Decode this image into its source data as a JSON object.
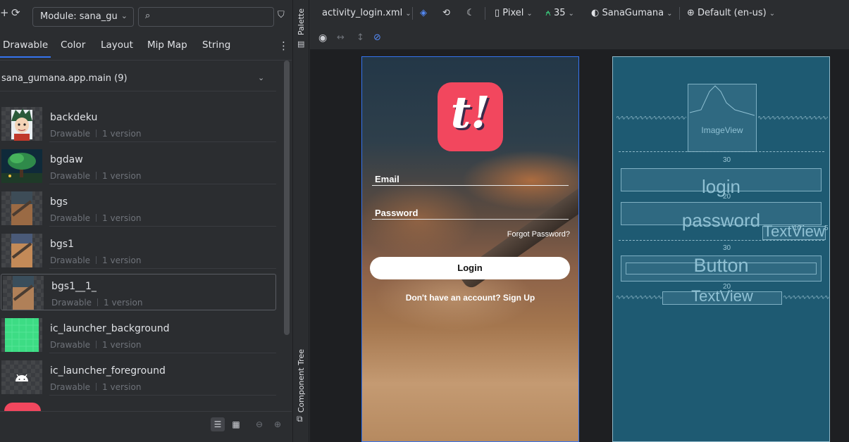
{
  "left_panel": {
    "module_label": "Module: sana_gu",
    "search_placeholder": "",
    "tabs": [
      {
        "label": "Drawable",
        "active": true
      },
      {
        "label": "Color"
      },
      {
        "label": "Layout"
      },
      {
        "label": "Mip Map"
      },
      {
        "label": "String"
      }
    ],
    "group_header": "sana_gumana.app.main (9)",
    "resources": [
      {
        "name": "backdeku",
        "type": "Drawable",
        "versions": "1 version"
      },
      {
        "name": "bgdaw",
        "type": "Drawable",
        "versions": "1 version"
      },
      {
        "name": "bgs",
        "type": "Drawable",
        "versions": "1 version"
      },
      {
        "name": "bgs1",
        "type": "Drawable",
        "versions": "1 version"
      },
      {
        "name": "bgs1__1_",
        "type": "Drawable",
        "versions": "1 version"
      },
      {
        "name": "ic_launcher_background",
        "type": "Drawable",
        "versions": "1 version"
      },
      {
        "name": "ic_launcher_foreground",
        "type": "Drawable",
        "versions": "1 version"
      }
    ]
  },
  "side_strip": {
    "palette_label": "Palette",
    "component_tree_label": "Component Tree"
  },
  "editor": {
    "toolbar": {
      "file": "activity_login.xml",
      "device": "Pixel",
      "api": "35",
      "theme": "SanaGumana",
      "locale": "Default (en-us)"
    }
  },
  "phone": {
    "logo_glyph": "t!",
    "email_label": "Email",
    "password_label": "Password",
    "forgot": "Forgot Password?",
    "login_button": "Login",
    "signup_text": "Don't have an account? Sign Up"
  },
  "blueprint": {
    "imageview": "ImageView",
    "login": "login",
    "password": "password",
    "textview_right": "TextView",
    "button": "Button",
    "textview_bottom": "TextView",
    "margin_30a": "30",
    "margin_20a": "20",
    "margin_30b": "30",
    "margin_20b": "20",
    "margin_10": "10",
    "margin_5": "5"
  },
  "colors": {
    "accent": "#3574f0",
    "logo": "#f2475e",
    "blueprint_bg": "#1e5a72"
  }
}
